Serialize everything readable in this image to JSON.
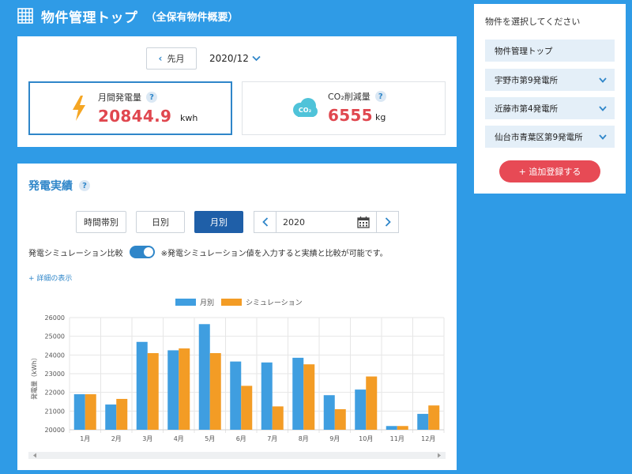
{
  "header": {
    "title": "物件管理トップ",
    "subtitle": "（全保有物件概要）"
  },
  "month_nav": {
    "prev_label": "先月",
    "current_month": "2020/12"
  },
  "stats": [
    {
      "label": "月間発電量",
      "value": "20844.9",
      "unit": "kwh",
      "icon": "lightning-icon"
    },
    {
      "label": "CO₂削減量",
      "value": "6555",
      "unit": "kg",
      "icon": "co2-cloud-icon"
    }
  ],
  "help_glyph": "?",
  "chart_section": {
    "title": "発電実績",
    "tabs": [
      "時間帯別",
      "日別",
      "月別"
    ],
    "active_tab": "月別",
    "year": "2020",
    "sim_label": "発電シミュレーション比較",
    "sim_note": "※発電シミュレーション値を入力すると実績と比較が可能です。",
    "detail_link": "+ 詳細の表示"
  },
  "chart_data": {
    "type": "bar",
    "categories": [
      "1月",
      "2月",
      "3月",
      "4月",
      "5月",
      "6月",
      "7月",
      "8月",
      "9月",
      "10月",
      "11月",
      "12月"
    ],
    "series": [
      {
        "name": "月別",
        "color": "#3f9ee0",
        "values": [
          21900,
          21350,
          24700,
          24250,
          25650,
          23650,
          23600,
          23850,
          21850,
          22150,
          20200,
          20850
        ]
      },
      {
        "name": "シミュレーション",
        "color": "#f39c25",
        "values": [
          21900,
          21650,
          24100,
          24350,
          24100,
          22350,
          21250,
          23500,
          21100,
          22850,
          20200,
          21300
        ]
      }
    ],
    "ylabel": "発電量（kWh）",
    "ylim": [
      20000,
      26000
    ],
    "yticks": [
      20000,
      21000,
      22000,
      23000,
      24000,
      25000,
      26000
    ],
    "grid": true,
    "legend": "top-center"
  },
  "sidebar": {
    "title": "物件を選択してください",
    "items": [
      {
        "label": "物件管理トップ",
        "chevron": false
      },
      {
        "label": "宇野市第9発電所",
        "chevron": true
      },
      {
        "label": "近藤市第4発電所",
        "chevron": true
      },
      {
        "label": "仙台市青葉区第9発電所",
        "chevron": true
      }
    ],
    "add_button": "+ 追加登録する"
  },
  "colors": {
    "background": "#2f9be6",
    "accent": "#2f86c9",
    "value_red": "#e0474f",
    "active_tab": "#1f5fa8",
    "add_button": "#e74a55"
  }
}
